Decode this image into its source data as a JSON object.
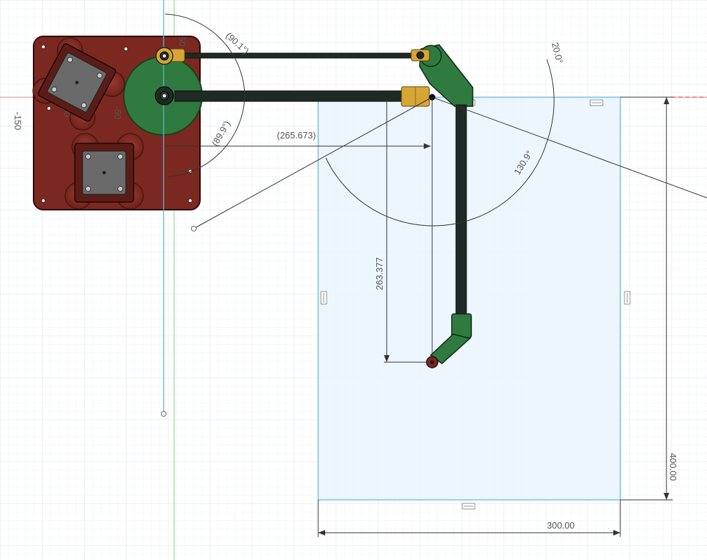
{
  "viewport": {
    "axis_labels": {
      "left": "-150",
      "plate_top": "50",
      "plate_mid": "-50",
      "plate_small": "0"
    }
  },
  "dimensions": {
    "upper_angle": "(90.1°)",
    "lower_angle": "(89.9°)",
    "horizontal_reach": "(265.673)",
    "vertical_reach": "263.377",
    "elbow_angle": "130.9°",
    "tilt_angle": "20.0°",
    "work_height": "400.00",
    "work_width": "300.00"
  },
  "colors": {
    "grid_minor": "#eef1f4",
    "grid_major": "#dde2e7",
    "axis_x": "#d94a4a",
    "axis_y": "#4bb94b",
    "sketch_blue": "#5ab4d8",
    "work_area_fill": "#e7f3fb",
    "base_plate": "#7b2820",
    "base_plate_edge": "#3a0f0b",
    "green_part": "#2f7a3e",
    "dark_rod": "#1f2a24",
    "brass": "#d6a634",
    "dimension_line": "#333333"
  },
  "icons": {
    "constraint_marker": "horizontal-constraint-icon"
  }
}
